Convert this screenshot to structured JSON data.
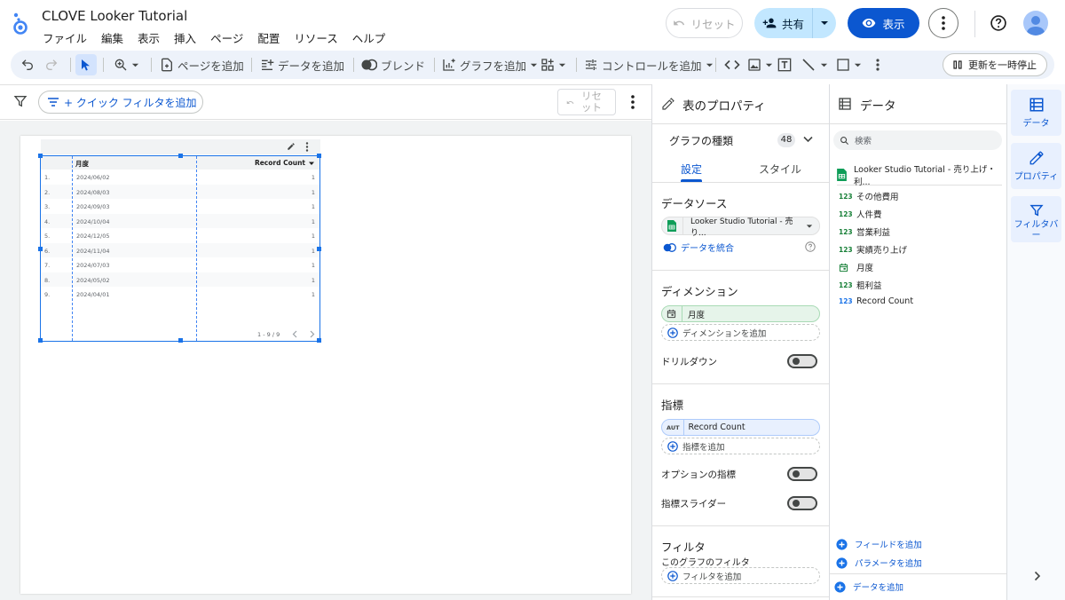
{
  "app": {
    "title": "CLOVE Looker Tutorial",
    "menu": [
      "ファイル",
      "編集",
      "表示",
      "挿入",
      "ページ",
      "配置",
      "リソース",
      "ヘルプ"
    ],
    "reset_label": "リセット",
    "share_label": "共有",
    "view_label": "表示"
  },
  "toolbar": {
    "add_page": "ページを追加",
    "add_data": "データを追加",
    "blend": "ブレンド",
    "add_chart": "グラフを追加",
    "add_control": "コントロールを追加",
    "pause_update": "更新を一時停止"
  },
  "filterbar": {
    "quick_filter": "+ クイック フィルタを追加",
    "reset_line1": "リセ",
    "reset_line2": "ット"
  },
  "table": {
    "columns": [
      "月度",
      "Record Count"
    ],
    "rows": [
      {
        "idx": "1.",
        "month": "2024/06/02",
        "count": "1"
      },
      {
        "idx": "2.",
        "month": "2024/08/03",
        "count": "1"
      },
      {
        "idx": "3.",
        "month": "2024/09/03",
        "count": "1"
      },
      {
        "idx": "4.",
        "month": "2024/10/04",
        "count": "1"
      },
      {
        "idx": "5.",
        "month": "2024/12/05",
        "count": "1"
      },
      {
        "idx": "6.",
        "month": "2024/11/04",
        "count": "1"
      },
      {
        "idx": "7.",
        "month": "2024/07/03",
        "count": "1"
      },
      {
        "idx": "8.",
        "month": "2024/05/02",
        "count": "1"
      },
      {
        "idx": "9.",
        "month": "2024/04/01",
        "count": "1"
      }
    ],
    "pager": "1 - 9 / 9"
  },
  "props": {
    "title": "表のプロパティ",
    "chart_type_label": "グラフの種類",
    "chart_type_count": "48",
    "tab_settings": "設定",
    "tab_style": "スタイル",
    "datasource_title": "データソース",
    "datasource_name": "Looker Studio Tutorial - 売り...",
    "blend_data": "データを統合",
    "dimension_title": "ディメンション",
    "dimension_value": "月度",
    "add_dimension": "ディメンションを追加",
    "drilldown": "ドリルダウン",
    "metric_title": "指標",
    "metric_type": "AUT",
    "metric_value": "Record Count",
    "add_metric": "指標を追加",
    "optional_metrics": "オプションの指標",
    "metric_slider": "指標スライダー",
    "filter_title": "フィルタ",
    "filter_subtitle": "このグラフのフィルタ",
    "add_filter": "フィルタを追加"
  },
  "data_panel": {
    "title": "データ",
    "search_placeholder": "検索",
    "source_name": "Looker Studio Tutorial - 売り上げ・利...",
    "fields": [
      {
        "type": "123",
        "name": "その他費用"
      },
      {
        "type": "123",
        "name": "人件費"
      },
      {
        "type": "123",
        "name": "営業利益"
      },
      {
        "type": "123",
        "name": "実績売り上げ"
      },
      {
        "type": "date",
        "name": "月度"
      },
      {
        "type": "123",
        "name": "粗利益"
      },
      {
        "type": "123",
        "name": "Record Count"
      }
    ],
    "add_field": "フィールドを追加",
    "add_parameter": "パラメータを追加",
    "add_data": "データを追加"
  },
  "rail": {
    "data": "データ",
    "properties": "プロパティ",
    "filter_bar": "フィルタバー"
  },
  "colors": {
    "accent": "#0b57d0",
    "share_bg": "#c2e7ff",
    "toolbar_bg": "#edf2fa",
    "selection": "#1a73e8",
    "chip_green": "#e6f4ea",
    "chip_blue": "#e8f0fe"
  }
}
